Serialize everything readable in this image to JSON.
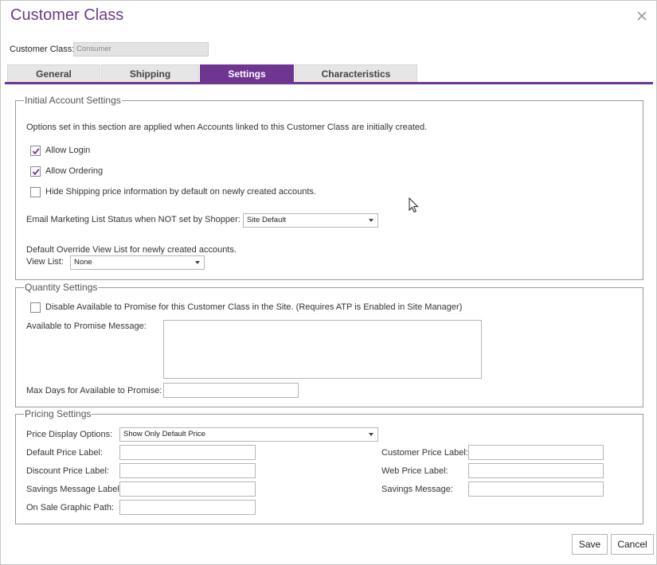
{
  "dialog": {
    "title": "Customer Class",
    "close_icon": "close-icon",
    "customer_class_label": "Customer Class:",
    "customer_class_value": "Consumer"
  },
  "tabs": [
    {
      "label": "General",
      "active": false
    },
    {
      "label": "Shipping",
      "active": false
    },
    {
      "label": "Settings",
      "active": true
    },
    {
      "label": "Characteristics",
      "active": false
    }
  ],
  "initial": {
    "legend": "Initial Account Settings",
    "description": "Options set in this section are applied when Accounts linked to this Customer Class are initially created.",
    "allow_login": {
      "label": "Allow Login",
      "checked": true
    },
    "allow_ordering": {
      "label": "Allow Ordering",
      "checked": true
    },
    "hide_shipping": {
      "label": "Hide Shipping price information by default on newly created accounts.",
      "checked": false
    },
    "email_label": "Email Marketing List Status when NOT set by Shopper:",
    "email_value": "Site Default",
    "override_label": "Default Override View List for newly created accounts.",
    "view_list_label": "View List:",
    "view_list_value": "None"
  },
  "quantity": {
    "legend": "Quantity Settings",
    "disable_atp": {
      "label": "Disable Available to Promise for this Customer Class in the Site. (Requires ATP is Enabled in Site Manager)",
      "checked": false
    },
    "atp_message_label": "Available to Promise Message:",
    "atp_message_value": "",
    "max_days_label": "Max Days for Available to Promise:",
    "max_days_value": ""
  },
  "pricing": {
    "legend": "Pricing Settings",
    "display_label": "Price Display Options:",
    "display_value": "Show Only Default Price",
    "default_price_label": "Default Price Label:",
    "discount_price_label": "Discount Price Label:",
    "savings_message_label_label": "Savings Message Label:",
    "on_sale_graphic_label": "On Sale Graphic Path:",
    "customer_price_label": "Customer Price Label:",
    "web_price_label": "Web Price Label:",
    "savings_message_label": "Savings Message:"
  },
  "footer": {
    "save_label": "Save",
    "cancel_label": "Cancel"
  },
  "colors": {
    "accent": "#6e3591",
    "title": "#6b3a8a"
  }
}
